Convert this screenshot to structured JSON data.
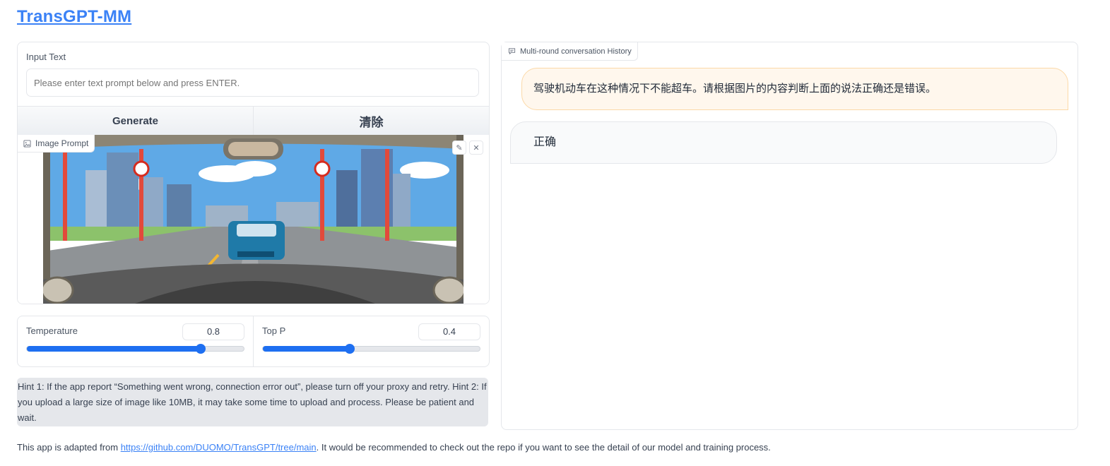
{
  "app": {
    "title": "TransGPT-MM"
  },
  "input": {
    "label": "Input Text",
    "placeholder": "Please enter text prompt below and press ENTER."
  },
  "buttons": {
    "generate": "Generate",
    "clear": "清除"
  },
  "image_prompt": {
    "label": "Image Prompt"
  },
  "sliders": {
    "temperature": {
      "label": "Temperature",
      "value": 0.8
    },
    "top_p": {
      "label": "Top P",
      "value": 0.4
    }
  },
  "hint": "Hint 1: If the app report “Something went wrong, connection error out”, please turn off your proxy and retry. Hint 2: If you upload a large size of image like 10MB, it may take some time to upload and process. Please be patient and wait.",
  "chat": {
    "label": "Multi-round conversation History",
    "messages": [
      {
        "role": "user",
        "text": "驾驶机动车在这种情况下不能超车。请根据图片的内容判断上面的说法正确还是错误。"
      },
      {
        "role": "bot",
        "text": "正确"
      }
    ]
  },
  "footer": {
    "prefix": "This app is adapted from ",
    "link": "https://github.com/DUOMO/TransGPT/tree/main",
    "suffix": ". It would be recommended to check out the repo if you want to see the detail of our model and training process."
  },
  "colors": {
    "accent": "#1e6ff1",
    "link": "#3b82f6",
    "user_bubble": "#fff7ed"
  }
}
